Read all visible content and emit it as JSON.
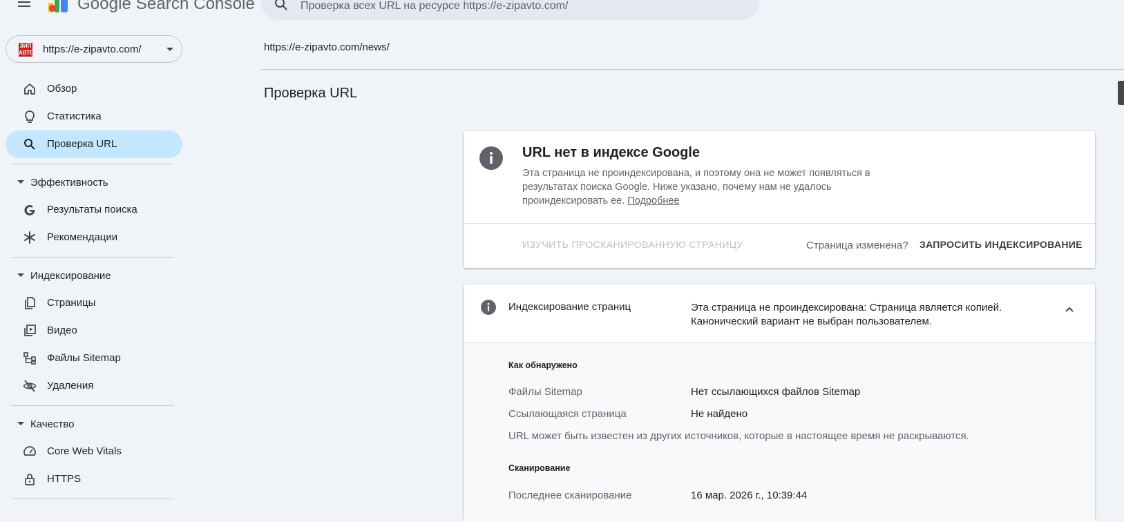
{
  "app": {
    "title": "Google Search Console"
  },
  "search": {
    "placeholder": "Проверка всех URL на ресурсе https://e-zipavto.com/"
  },
  "property": {
    "url": "https://e-zipavto.com/",
    "favicon_text": "ЗИП АВТО"
  },
  "sidebar": {
    "items": [
      {
        "label": "Обзор",
        "icon": "home-icon"
      },
      {
        "label": "Статистика",
        "icon": "lightbulb-icon"
      },
      {
        "label": "Проверка URL",
        "icon": "search-icon",
        "active": true
      }
    ],
    "sections": [
      {
        "label": "Эффективность",
        "items": [
          {
            "label": "Результаты поиска",
            "icon": "google-g-icon"
          },
          {
            "label": "Рекомендации",
            "icon": "asterisk-icon"
          }
        ]
      },
      {
        "label": "Индексирование",
        "items": [
          {
            "label": "Страницы",
            "icon": "pages-icon"
          },
          {
            "label": "Видео",
            "icon": "video-icon"
          },
          {
            "label": "Файлы Sitemap",
            "icon": "sitemap-icon"
          },
          {
            "label": "Удаления",
            "icon": "eye-off-icon"
          }
        ]
      },
      {
        "label": "Качество",
        "items": [
          {
            "label": "Core Web Vitals",
            "icon": "gauge-icon"
          },
          {
            "label": "HTTPS",
            "icon": "lock-icon"
          }
        ]
      }
    ]
  },
  "header": {
    "inspected_url": "https://e-zipavto.com/news/",
    "page_title": "Проверка URL"
  },
  "status_card": {
    "title": "URL нет в индексе Google",
    "description": "Эта страница не проиндексирована, и поэтому она не может появляться в результатах поиска Google. Ниже указано, почему нам не удалось проиндексировать ее.",
    "learn_more": "Подробнее",
    "inspect_button": "ИЗУЧИТЬ ПРОСКАНИРОВАННУЮ СТРАНИЦУ",
    "changed_question": "Страница изменена?",
    "request_button": "ЗАПРОСИТЬ ИНДЕКСИРОВАНИЕ"
  },
  "indexing_card": {
    "label": "Индексирование страниц",
    "value_line1": "Эта страница не проиндексирована: Страница является копией.",
    "value_line2": "Канонический вариант не выбран пользователем.",
    "discovery": {
      "heading": "Как обнаружено",
      "sitemaps_label": "Файлы Sitemap",
      "sitemaps_value": "Нет ссылающихся файлов Sitemap",
      "referring_label": "Ссылающаяся страница",
      "referring_value": "Не найдено",
      "note": "URL может быть известен из других источников, которые в настоящее время не раскрываются."
    },
    "crawl": {
      "heading": "Сканирование",
      "last_crawl_label": "Последнее сканирование",
      "last_crawl_value": "16 мар. 2026 г., 10:39:44"
    }
  },
  "colors": {
    "active_nav": "#c2e7ff",
    "background": "#f0f4f9",
    "info_icon": "#5f6368"
  }
}
